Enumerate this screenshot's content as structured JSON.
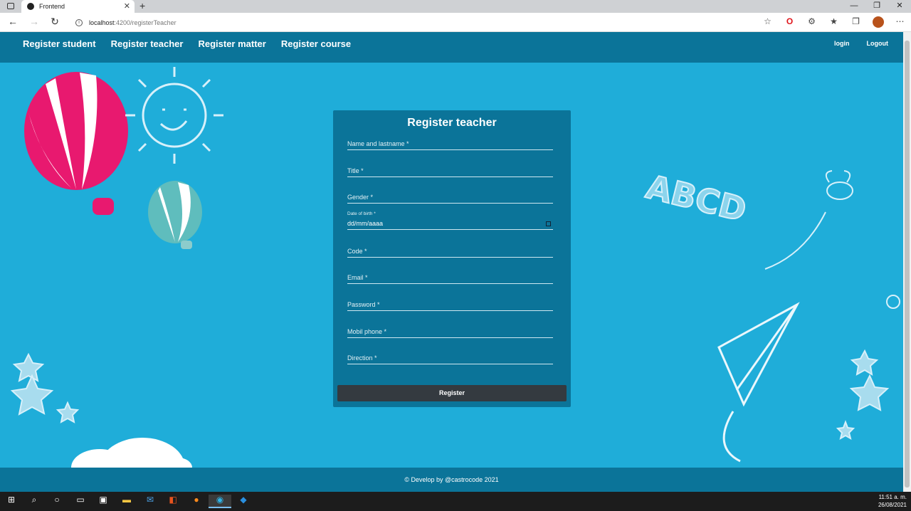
{
  "browser": {
    "tab_title": "Frontend",
    "new_tab": "+",
    "url_host": "localhost",
    "url_path": ":4200/registerTeacher",
    "window_controls": [
      "—",
      "❐",
      "✕"
    ]
  },
  "nav": {
    "items": [
      {
        "label": "Register student"
      },
      {
        "label": "Register teacher"
      },
      {
        "label": "Register matter"
      },
      {
        "label": "Register course"
      }
    ],
    "right": [
      {
        "label": "login"
      },
      {
        "label": "Logout"
      }
    ]
  },
  "form": {
    "title": "Register teacher",
    "fields": [
      {
        "label": "Name and lastname *"
      },
      {
        "label": "Title *"
      },
      {
        "label": "Gender *"
      },
      {
        "label": "Date of birth *",
        "value": "dd/mm/aaaa"
      },
      {
        "label": "Code *"
      },
      {
        "label": "Email *"
      },
      {
        "label": "Password *"
      },
      {
        "label": "Mobil phone *"
      },
      {
        "label": "Direction *"
      }
    ],
    "submit_label": "Register"
  },
  "footer": {
    "text": "© Develop by @castrocode 2021"
  },
  "taskbar": {
    "time": "11:51 a. m.",
    "date": "26/08/2021"
  },
  "colors": {
    "page_bg": "#1fadd9",
    "header_bg": "#0b7499",
    "button_bg": "#343a40"
  }
}
